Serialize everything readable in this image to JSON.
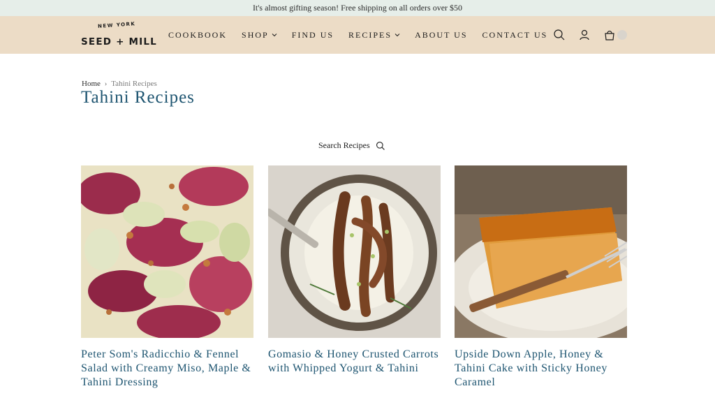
{
  "announcement": "It's almost gifting season! Free shipping on all orders over $50",
  "logo": {
    "top": "NEW YORK",
    "main": "SEED + MILL"
  },
  "nav": [
    {
      "label": "COOKBOOK",
      "dropdown": false
    },
    {
      "label": "SHOP",
      "dropdown": true
    },
    {
      "label": "FIND US",
      "dropdown": false
    },
    {
      "label": "RECIPES",
      "dropdown": true
    },
    {
      "label": "ABOUT US",
      "dropdown": false
    },
    {
      "label": "CONTACT US",
      "dropdown": false
    }
  ],
  "header_icons": [
    "search-icon",
    "account-icon",
    "cart-icon"
  ],
  "breadcrumb": {
    "home": "Home",
    "current": "Tahini Recipes"
  },
  "page_title": "Tahini Recipes",
  "search": {
    "label": "Search Recipes"
  },
  "recipes": [
    {
      "title": "Peter Som's Radicchio & Fennel Salad with Creamy Miso, Maple & Tahini Dressing"
    },
    {
      "title": "Gomasio & Honey Crusted Carrots with Whipped Yogurt & Tahini"
    },
    {
      "title": "Upside Down Apple, Honey & Tahini Cake with Sticky Honey Caramel"
    }
  ],
  "colors": {
    "accent": "#1d5470",
    "header_bg": "#ecdcc6",
    "announcement_bg": "#e6eee9"
  }
}
